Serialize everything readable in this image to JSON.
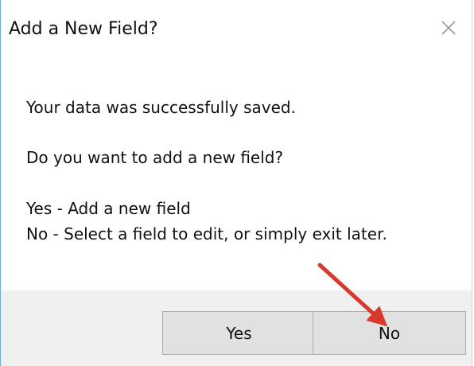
{
  "dialog": {
    "title": "Add a New Field?",
    "close_icon": "close-icon",
    "messages": {
      "saved": "Your data was successfully saved.",
      "question": "Do you want to add a new field?",
      "option_yes": "Yes - Add a new field",
      "option_no": "No - Select a field to edit, or simply exit later."
    },
    "buttons": {
      "yes_label": "Yes",
      "no_label": "No"
    }
  },
  "annotation": {
    "arrow_icon": "red-arrow-icon",
    "arrow_color": "#d9382c"
  },
  "colors": {
    "footer_bg": "#f0f0f0",
    "window_border": "#6fa8dc"
  }
}
